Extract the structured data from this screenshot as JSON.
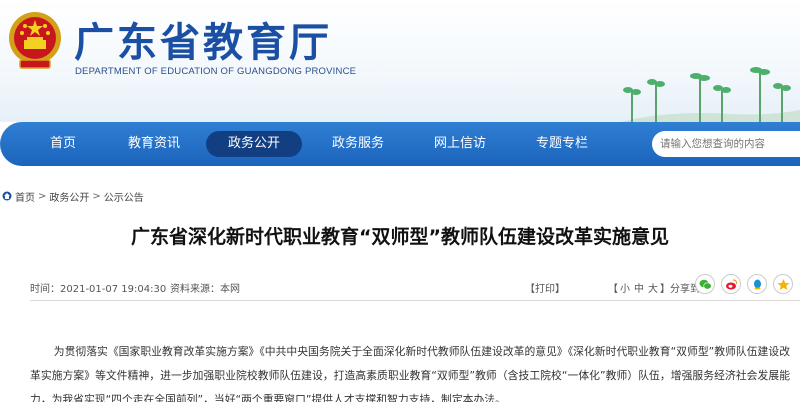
{
  "header": {
    "title": "广东省教育厅",
    "subtitle": "DEPARTMENT OF EDUCATION OF GUANGDONG PROVINCE"
  },
  "nav": {
    "items": [
      {
        "label": "首页"
      },
      {
        "label": "教育资讯"
      },
      {
        "label": "政务公开"
      },
      {
        "label": "政务服务"
      },
      {
        "label": "网上信访"
      },
      {
        "label": "专题专栏"
      }
    ],
    "active_index": 2,
    "search_placeholder": "请输入您想查询的内容"
  },
  "breadcrumb": {
    "items": [
      "首页",
      "政务公开",
      "公示公告"
    ],
    "separator": ">"
  },
  "article": {
    "title": "广东省深化新时代职业教育“双师型”教师队伍建设改革实施意见",
    "time": "时间：2021-01-07 19:04:30",
    "source": "资料来源：本网",
    "print_label": "【打印】",
    "font_prefix": "【",
    "font_small": "小",
    "font_medium": "中",
    "font_large": "大",
    "font_suffix": "】",
    "share_label": "分享到：",
    "body": "为贯彻落实《国家职业教育改革实施方案》《中共中央国务院关于全面深化新时代教师队伍建设改革的意见》《深化新时代职业教育“双师型”教师队伍建设改革实施方案》等文件精神，进一步加强职业院校教师队伍建设，打造高素质职业教育“双师型”教师（含技工院校“一体化”教师）队伍，增强服务经济社会发展能力，为我省实现“四个走在全国前列”，当好“两个重要窗口”提供人才支撑和智力支持，制定本办法。"
  },
  "share": {
    "icons": [
      "wechat-icon",
      "weibo-icon",
      "qq-icon",
      "qzone-icon"
    ]
  },
  "colors": {
    "brand_blue": "#1a4fa3",
    "nav_blue": "#2270c8",
    "nav_active": "#123f82"
  }
}
